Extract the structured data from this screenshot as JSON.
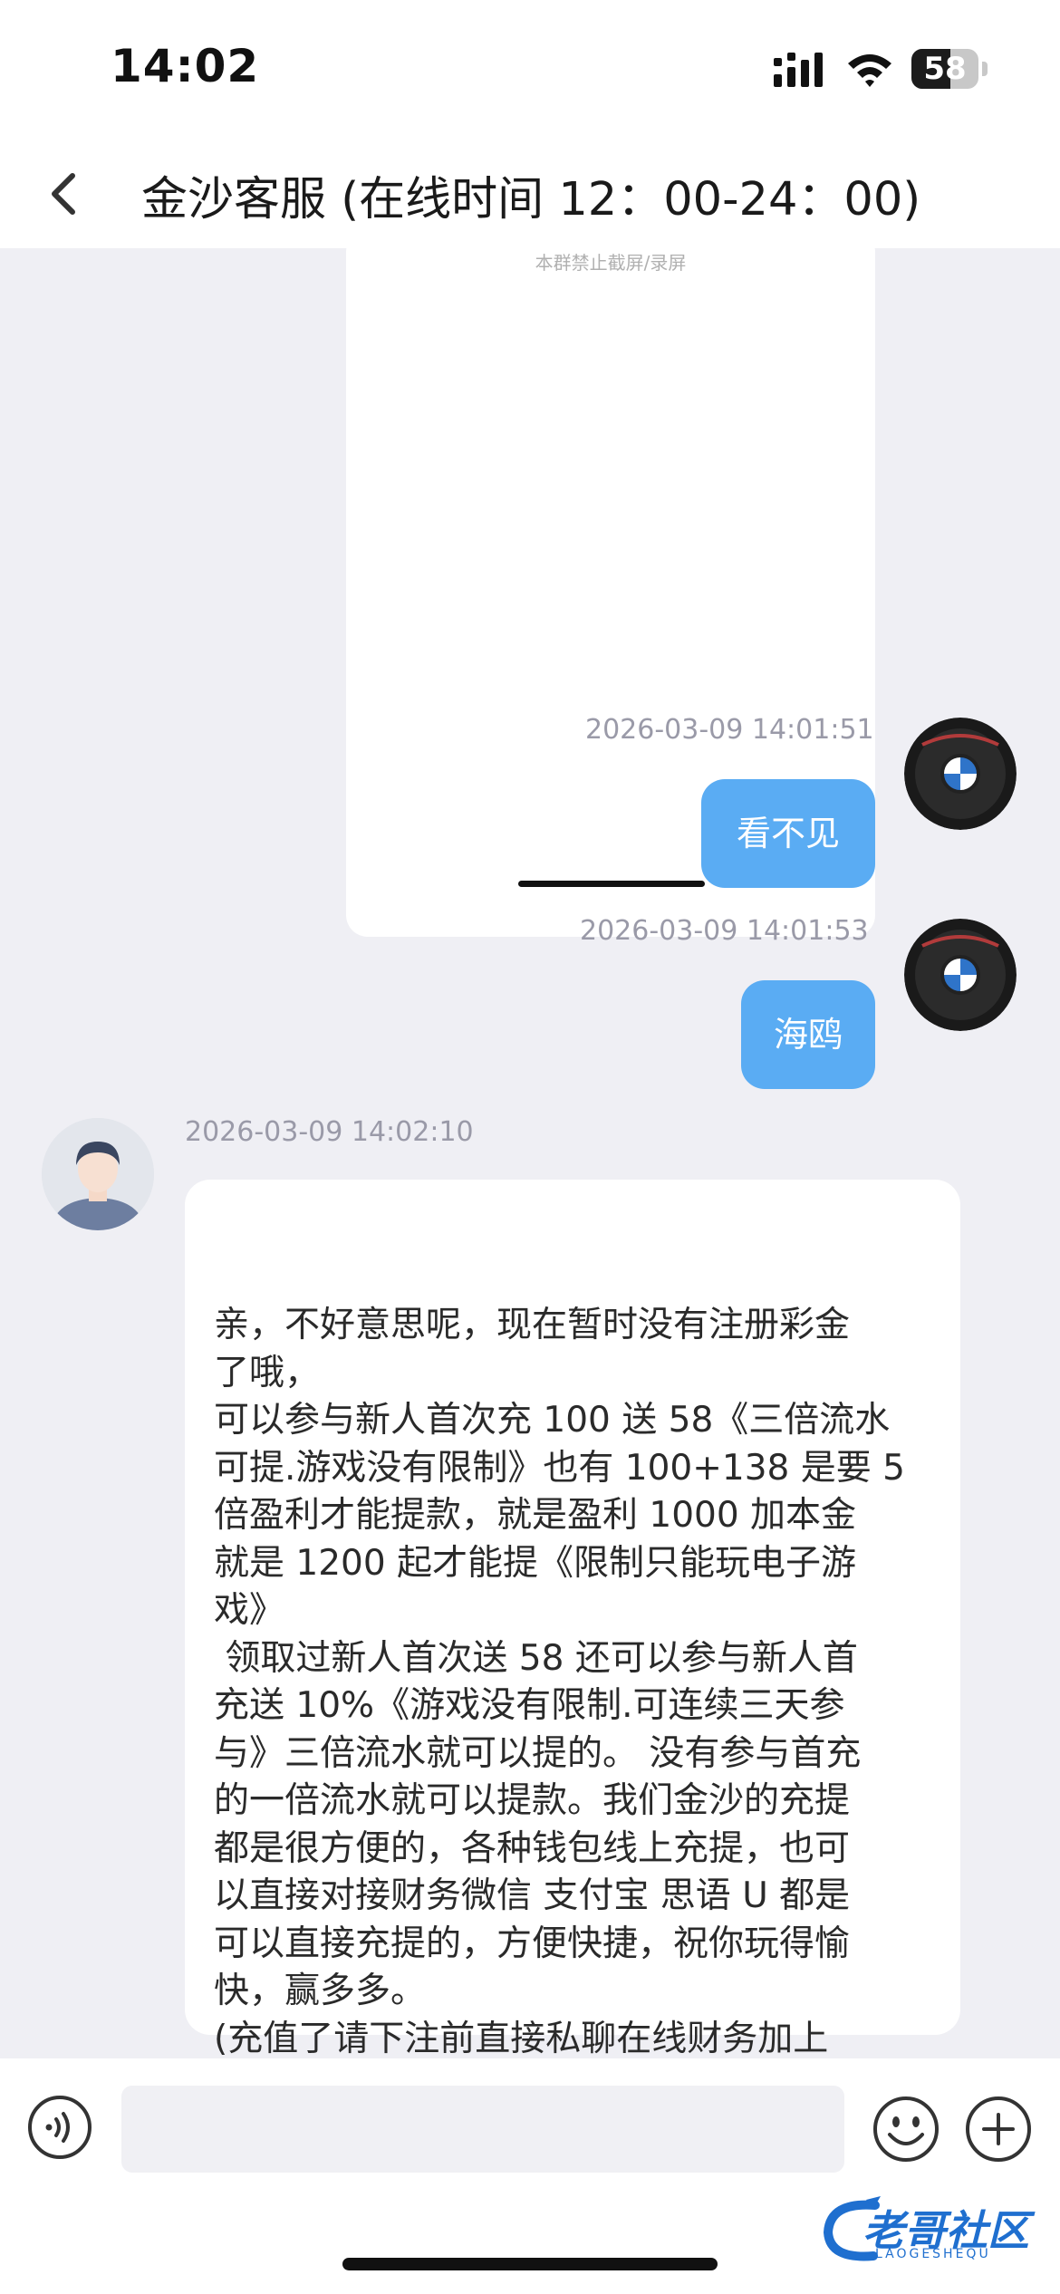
{
  "status_bar": {
    "time": "14:02",
    "battery_percent": "58"
  },
  "header": {
    "title": "金沙客服 (在线时间 12：00-24：00)"
  },
  "chat": {
    "image_message": {
      "caption": "本群禁止截屏/录屏"
    },
    "messages": [
      {
        "direction": "outgoing",
        "timestamp": "2026-03-09 14:01:51",
        "text": "看不见"
      },
      {
        "direction": "outgoing",
        "timestamp": "2026-03-09 14:01:53",
        "text": "海鸥"
      },
      {
        "direction": "incoming",
        "timestamp": "2026-03-09 14:02:10",
        "text": "亲，不好意思呢，现在暂时没有注册彩金\n了哦，\n可以参与新人首次充 100 送 58《三倍流水\n可提.游戏没有限制》也有 100+138 是要 5\n倍盈利才能提款，就是盈利 1000 加本金\n就是 1200 起才能提《限制只能玩电子游\n戏》\n 领取过新人首次送 58 还可以参与新人首\n充送 10%《游戏没有限制.可连续三天参\n与》三倍流水就可以提的。 没有参与首充\n的一倍流水就可以提款。我们金沙的充提\n都是很方便的，各种钱包线上充提，也可\n以直接对接财务微信 支付宝 思语 U 都是\n可以直接充提的，方便快捷，祝你玩得愉\n快，赢多多。\n(充值了请下注前直接私聊在线财务加上\n就可以了)"
      }
    ]
  },
  "input_bar": {
    "placeholder": "",
    "value": ""
  },
  "watermark": {
    "text": "老哥社区",
    "sub": "LAOGESHEQU"
  },
  "colors": {
    "outgoing_bubble": "#5aacf3",
    "incoming_bubble": "#ffffff",
    "background": "#efeff4"
  },
  "icons": [
    "signal-icon",
    "wifi-icon",
    "battery-icon",
    "back-chevron-icon",
    "voice-icon",
    "emoji-icon",
    "plus-icon"
  ]
}
